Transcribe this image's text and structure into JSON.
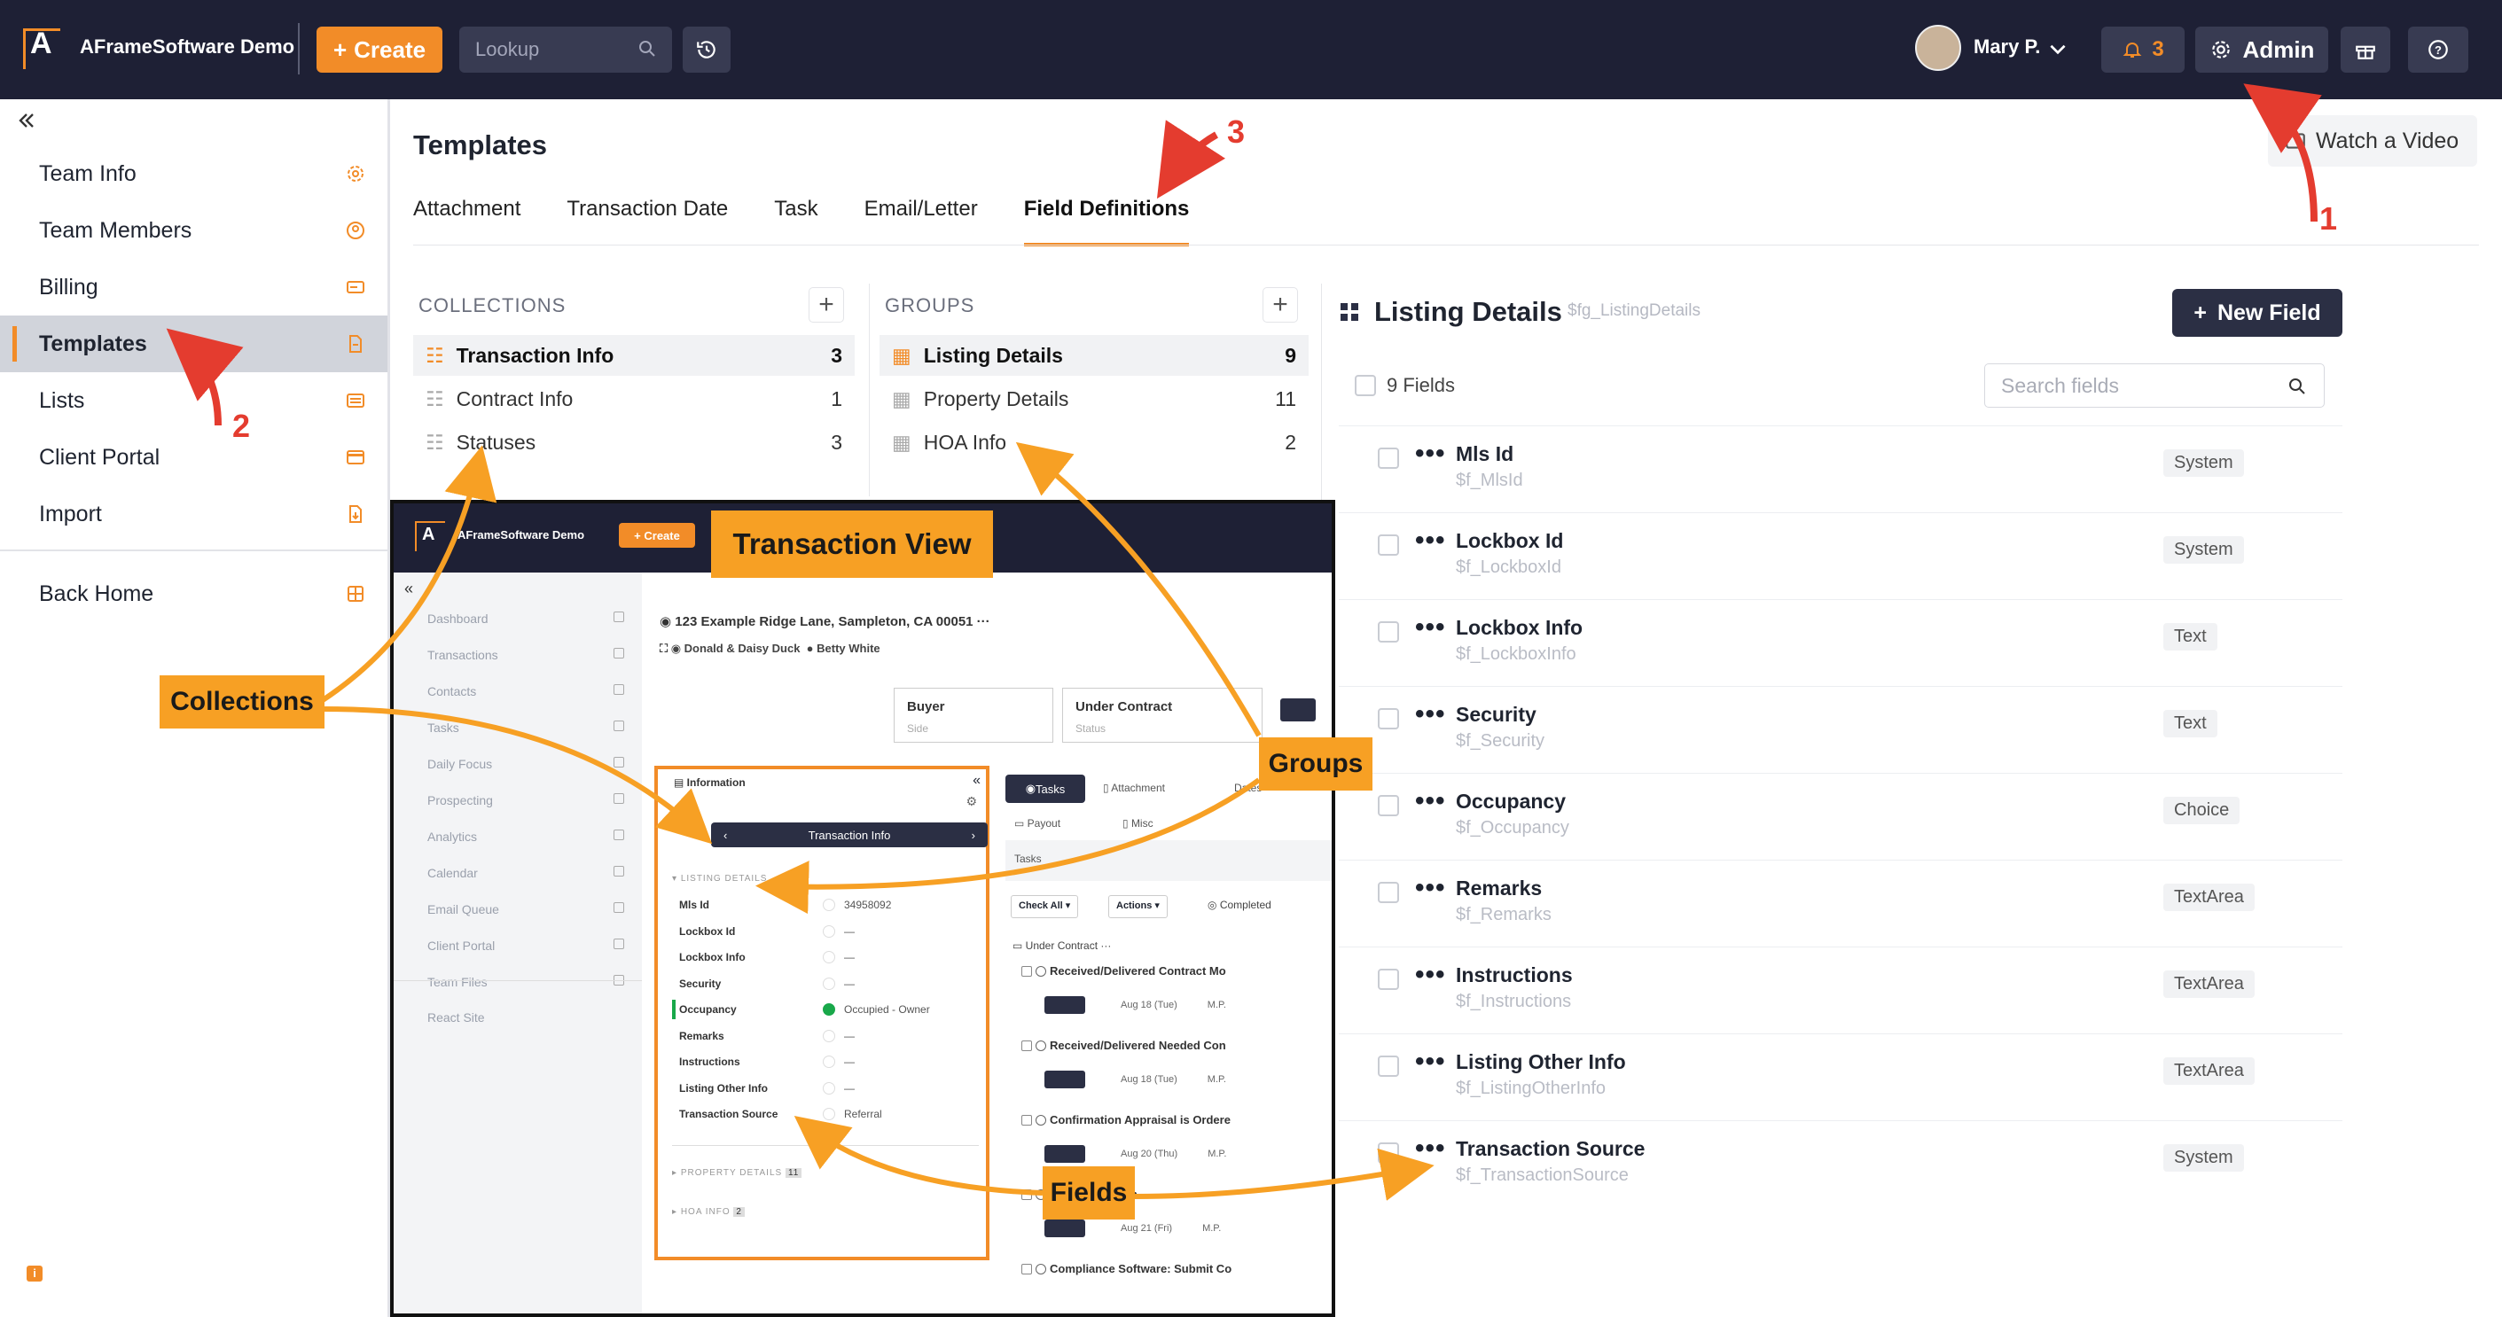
{
  "topbar": {
    "app_title": "AFrameSoftware Demo",
    "create_label": "Create",
    "lookup_placeholder": "Lookup",
    "user_name": "Mary P.",
    "notification_count": "3",
    "admin_label": "Admin"
  },
  "sidebar": {
    "items": [
      {
        "label": "Team Info",
        "icon": "gear-icon"
      },
      {
        "label": "Team Members",
        "icon": "user-circle-icon"
      },
      {
        "label": "Billing",
        "icon": "billing-icon"
      },
      {
        "label": "Templates",
        "icon": "document-icon"
      },
      {
        "label": "Lists",
        "icon": "list-icon"
      },
      {
        "label": "Client Portal",
        "icon": "card-icon"
      },
      {
        "label": "Import",
        "icon": "import-icon"
      }
    ],
    "back_home": "Back Home"
  },
  "main": {
    "title": "Templates",
    "watch_video": "Watch a Video",
    "tabs": [
      "Attachment",
      "Transaction Date",
      "Task",
      "Email/Letter",
      "Field Definitions"
    ],
    "active_tab": "Field Definitions"
  },
  "collections": {
    "header": "COLLECTIONS",
    "items": [
      {
        "name": "Transaction Info",
        "count": "3"
      },
      {
        "name": "Contract Info",
        "count": "1"
      },
      {
        "name": "Statuses",
        "count": "3"
      }
    ]
  },
  "groups": {
    "header": "GROUPS",
    "items": [
      {
        "name": "Listing Details",
        "count": "9"
      },
      {
        "name": "Property Details",
        "count": "11"
      },
      {
        "name": "HOA Info",
        "count": "2"
      }
    ]
  },
  "panel": {
    "title": "Listing Details",
    "key": "$fg_ListingDetails",
    "new_field": "New Field",
    "fields_count": "9 Fields",
    "search_placeholder": "Search fields",
    "fields": [
      {
        "name": "Mls Id",
        "key": "$f_MlsId",
        "type": "System"
      },
      {
        "name": "Lockbox Id",
        "key": "$f_LockboxId",
        "type": "System"
      },
      {
        "name": "Lockbox Info",
        "key": "$f_LockboxInfo",
        "type": "Text"
      },
      {
        "name": "Security",
        "key": "$f_Security",
        "type": "Text"
      },
      {
        "name": "Occupancy",
        "key": "$f_Occupancy",
        "type": "Choice"
      },
      {
        "name": "Remarks",
        "key": "$f_Remarks",
        "type": "TextArea"
      },
      {
        "name": "Instructions",
        "key": "$f_Instructions",
        "type": "TextArea"
      },
      {
        "name": "Listing Other Info",
        "key": "$f_ListingOtherInfo",
        "type": "TextArea"
      },
      {
        "name": "Transaction Source",
        "key": "$f_TransactionSource",
        "type": "System"
      }
    ]
  },
  "annotations": {
    "transaction_view": "Transaction View",
    "collections": "Collections",
    "groups": "Groups",
    "fields": "Fields",
    "step1": "1",
    "step2": "2",
    "step3": "3",
    "accent": "#f7a024",
    "arrow_color": "#e43c2f"
  },
  "embedded": {
    "app_title": "AFrameSoftware Demo",
    "create_label": "Create",
    "nav": [
      "Dashboard",
      "Transactions",
      "Contacts",
      "Tasks",
      "Daily Focus",
      "Prospecting",
      "Analytics",
      "Calendar",
      "Email Queue",
      "Client Portal",
      "Team Files"
    ],
    "react_site": "React Site",
    "address": "123 Example Ridge Lane, Sampleton, CA 00051",
    "people": "Donald & Daisy Duck",
    "agent": "Betty White",
    "side_label": "Buyer",
    "side_sub": "Side",
    "status_label": "Under Contract",
    "status_sub": "Status",
    "info_title": "Information",
    "collection_bar": "Transaction Info",
    "listing_details": "LISTING DETAILS",
    "property_details": "PROPERTY DETAILS",
    "property_count": "11",
    "hoa_info": "HOA INFO",
    "hoa_count": "2",
    "fields": [
      {
        "name": "Mls Id",
        "value": "34958092"
      },
      {
        "name": "Lockbox Id",
        "value": "—"
      },
      {
        "name": "Lockbox Info",
        "value": "—"
      },
      {
        "name": "Security",
        "value": "—"
      },
      {
        "name": "Occupancy",
        "value": "Occupied - Owner"
      },
      {
        "name": "Remarks",
        "value": "—"
      },
      {
        "name": "Instructions",
        "value": "—"
      },
      {
        "name": "Listing Other Info",
        "value": "—"
      },
      {
        "name": "Transaction Source",
        "value": "Referral"
      }
    ],
    "tabs": {
      "tasks": "Tasks",
      "attachments": "Attachment",
      "dates": "Dates",
      "payout": "Payout",
      "misc": "Misc"
    },
    "tasks_section": "Tasks",
    "check_all": "Check All",
    "actions": "Actions",
    "completed": "Completed",
    "under_contract": "Under Contract",
    "tasks": [
      {
        "title": "Received/Delivered Contract Mo",
        "date": "Aug 18 (Tue)",
        "who": "M.P."
      },
      {
        "title": "Received/Delivered Needed Con",
        "date": "Aug 18 (Tue)",
        "who": "M.P."
      },
      {
        "title": "Confirmation Appraisal is Ordere",
        "date": "Aug 20 (Thu)",
        "who": "M.P."
      },
      {
        "title": "Client: Check-In",
        "date": "Aug 21 (Fri)",
        "who": "M.P."
      },
      {
        "title": "Compliance Software: Submit Co",
        "date": "",
        "who": ""
      }
    ]
  }
}
